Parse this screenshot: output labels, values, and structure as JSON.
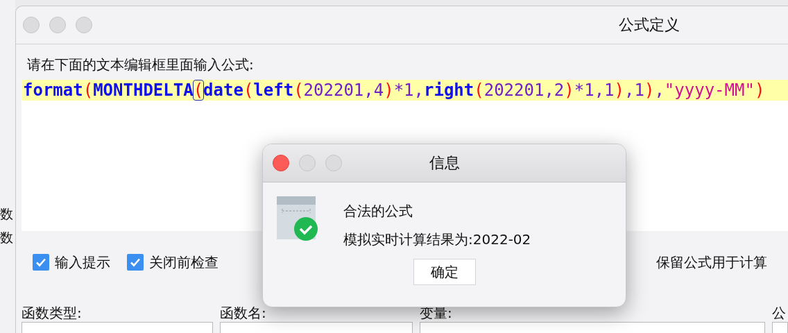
{
  "side_labels": [
    "数",
    "数"
  ],
  "window": {
    "title": "公式定义"
  },
  "prompt": "请在下面的文本编辑框里面输入公式:",
  "formula": [
    {
      "kind": "function",
      "text": "format"
    },
    {
      "kind": "paren",
      "text": "("
    },
    {
      "kind": "function",
      "text": "MONTHDELTA"
    },
    {
      "kind": "matched-paren",
      "text": "("
    },
    {
      "kind": "function",
      "text": "date"
    },
    {
      "kind": "paren",
      "text": "("
    },
    {
      "kind": "function",
      "text": "left"
    },
    {
      "kind": "paren",
      "text": "("
    },
    {
      "kind": "number",
      "text": "202201,4"
    },
    {
      "kind": "paren",
      "text": ")"
    },
    {
      "kind": "number",
      "text": "*1,"
    },
    {
      "kind": "function",
      "text": "right"
    },
    {
      "kind": "paren",
      "text": "("
    },
    {
      "kind": "number",
      "text": "202201,2"
    },
    {
      "kind": "paren",
      "text": ")"
    },
    {
      "kind": "number",
      "text": "*1,1"
    },
    {
      "kind": "paren",
      "text": ")"
    },
    {
      "kind": "number",
      "text": ",1"
    },
    {
      "kind": "paren",
      "text": ")"
    },
    {
      "kind": "number",
      "text": ","
    },
    {
      "kind": "string",
      "text": "\"yyyy-MM\""
    },
    {
      "kind": "paren",
      "text": ")"
    }
  ],
  "options": [
    {
      "label": "输入提示",
      "checked": true
    },
    {
      "label": "关闭前检查",
      "checked": true
    }
  ],
  "retain_label": "保留公式用于计算",
  "field_labels": [
    "函数类型:",
    "函数名:",
    "变量:",
    "公"
  ],
  "dialog": {
    "title": "信息",
    "heading": "合法的公式",
    "result": "模拟实时计算结果为:2022-02",
    "button": "确定"
  }
}
